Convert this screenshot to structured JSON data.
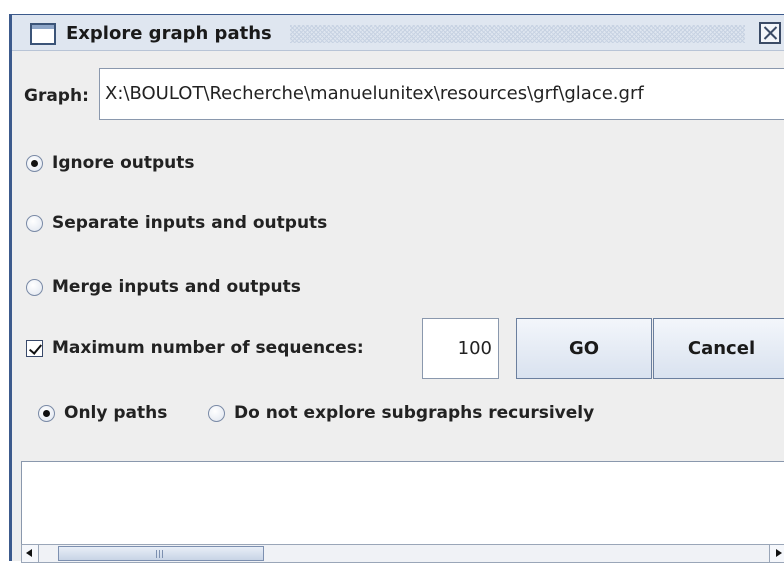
{
  "window": {
    "title": "Explore graph paths"
  },
  "graph": {
    "label": "Graph:",
    "value": "X:\\BOULOT\\Recherche\\manuelunitex\\resources\\grf\\glace.grf"
  },
  "output_mode": {
    "options": [
      {
        "label": "Ignore outputs",
        "selected": true
      },
      {
        "label": "Separate inputs and outputs",
        "selected": false
      },
      {
        "label": "Merge inputs and outputs",
        "selected": false
      }
    ]
  },
  "max_sequences": {
    "label": "Maximum number of sequences:",
    "checked": true,
    "value": "100"
  },
  "buttons": {
    "go": "GO",
    "cancel": "Cancel"
  },
  "explore_mode": {
    "options": [
      {
        "label": "Only paths",
        "selected": true
      },
      {
        "label": "Do not explore subgraphs recursively",
        "selected": false
      }
    ]
  }
}
